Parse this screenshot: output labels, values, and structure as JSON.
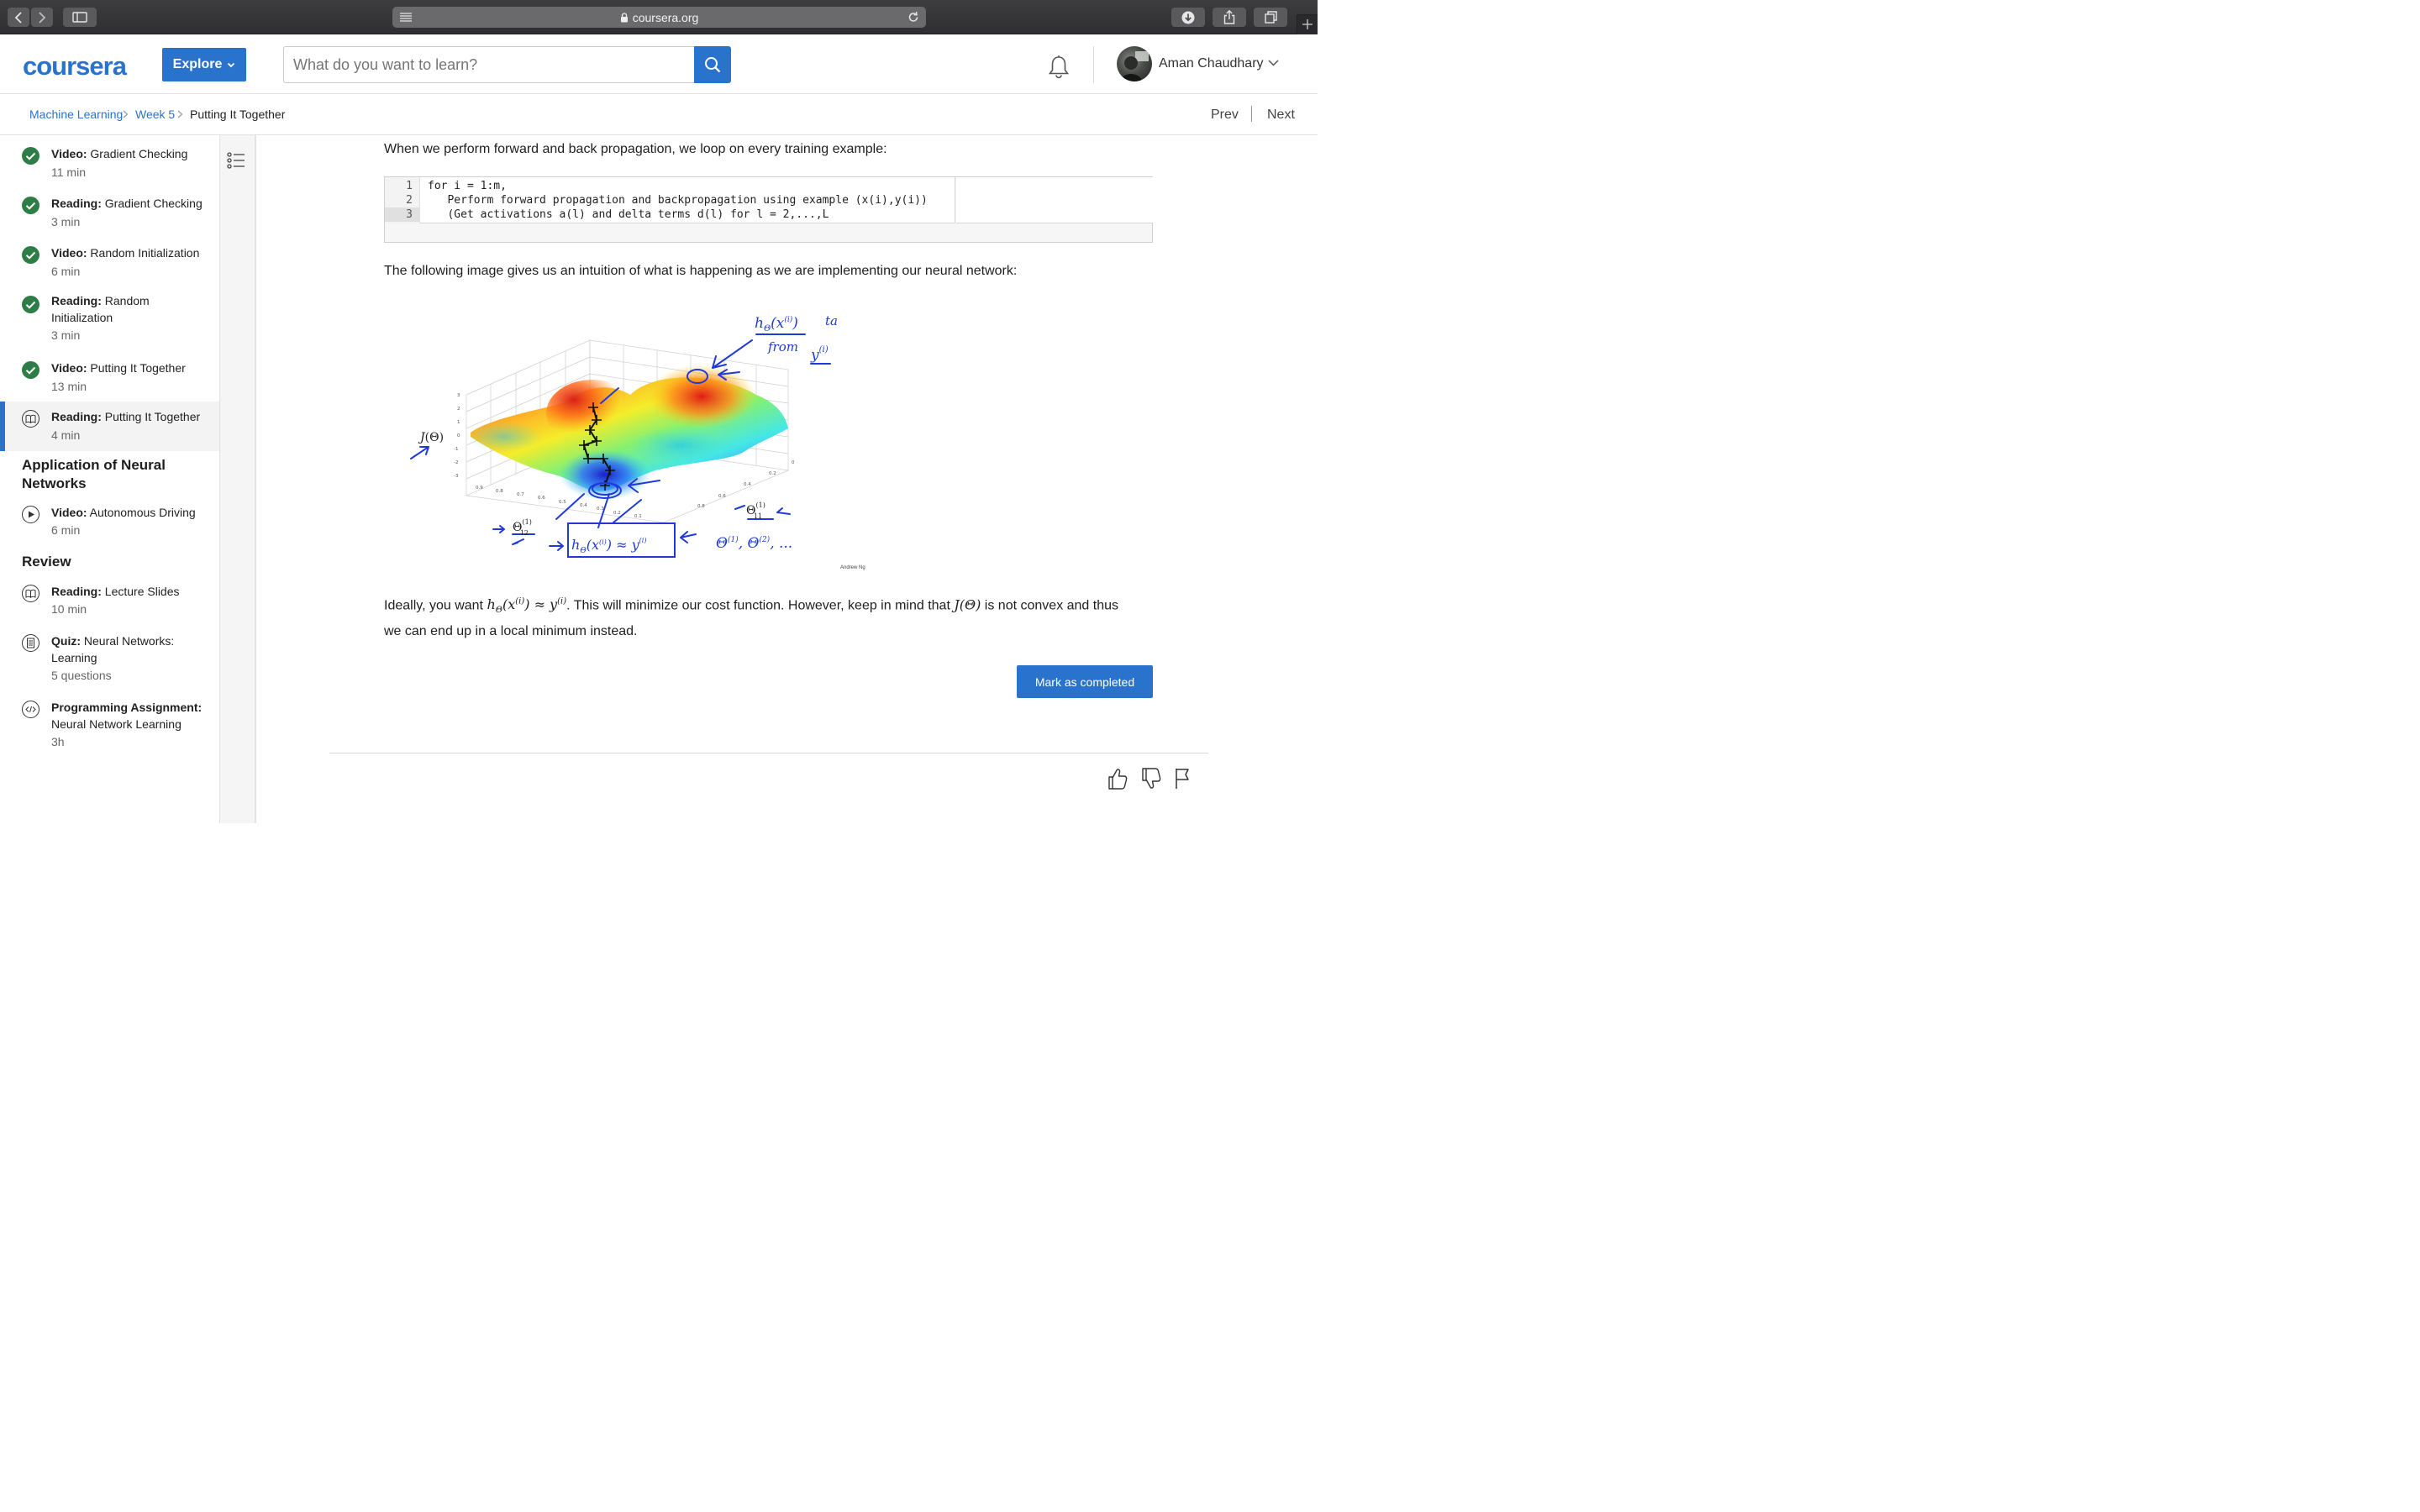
{
  "browser": {
    "url": "coursera.org"
  },
  "header": {
    "logo": "coursera",
    "explore_label": "Explore",
    "search_placeholder": "What do you want to learn?",
    "user_name": "Aman Chaudhary"
  },
  "breadcrumb": {
    "items": [
      "Machine Learning",
      "Week 5",
      "Putting It Together"
    ],
    "prev": "Prev",
    "next": "Next"
  },
  "sidebar": {
    "items": [
      {
        "type": "Video:",
        "title": "Gradient Checking",
        "meta": "11 min",
        "status": "completed"
      },
      {
        "type": "Reading:",
        "title": "Gradient Checking",
        "meta": "3 min",
        "status": "completed"
      },
      {
        "type": "Video:",
        "title": "Random Initialization",
        "meta": "6 min",
        "status": "completed"
      },
      {
        "type": "Reading:",
        "title": "Random Initialization",
        "meta": "3 min",
        "status": "completed"
      },
      {
        "type": "Video:",
        "title": "Putting It Together",
        "meta": "13 min",
        "status": "completed"
      },
      {
        "type": "Reading:",
        "title": "Putting It Together",
        "meta": "4 min",
        "status": "current"
      }
    ],
    "section2_title": "Application of Neural Networks",
    "section2_items": [
      {
        "type": "Video:",
        "title": "Autonomous Driving",
        "meta": "6 min"
      }
    ],
    "section3_title": "Review",
    "section3_items": [
      {
        "type": "Reading:",
        "title": "Lecture Slides",
        "meta": "10 min"
      },
      {
        "type": "Quiz:",
        "title": "Neural Networks: Learning",
        "meta": "5 questions"
      },
      {
        "type": "Programming Assignment:",
        "title": "Neural Network Learning",
        "meta": "3h"
      }
    ]
  },
  "content": {
    "p1": "When we perform forward and back propagation, we loop on every training example:",
    "code_lines": [
      {
        "n": "1",
        "text": "for i = 1:m,"
      },
      {
        "n": "2",
        "text": "   Perform forward propagation and backpropagation using example (x(i),y(i))"
      },
      {
        "n": "3",
        "text": "   (Get activations a(l) and delta terms d(l) for l = 2,...,L"
      }
    ],
    "p2": "The following image gives us an intuition of what is happening as we are implementing our neural network:",
    "p3_a": "Ideally, you want ",
    "p3_b": ". This will minimize our cost function. However, keep in mind that ",
    "p3_c": " is not convex and thus",
    "p3_d": "we can end up in a local minimum instead.",
    "figure_credit": "Andrew Ng",
    "mark_completed": "Mark as completed"
  },
  "colors": {
    "brand": "#2a73cc",
    "completed_green": "#2e7d46"
  }
}
